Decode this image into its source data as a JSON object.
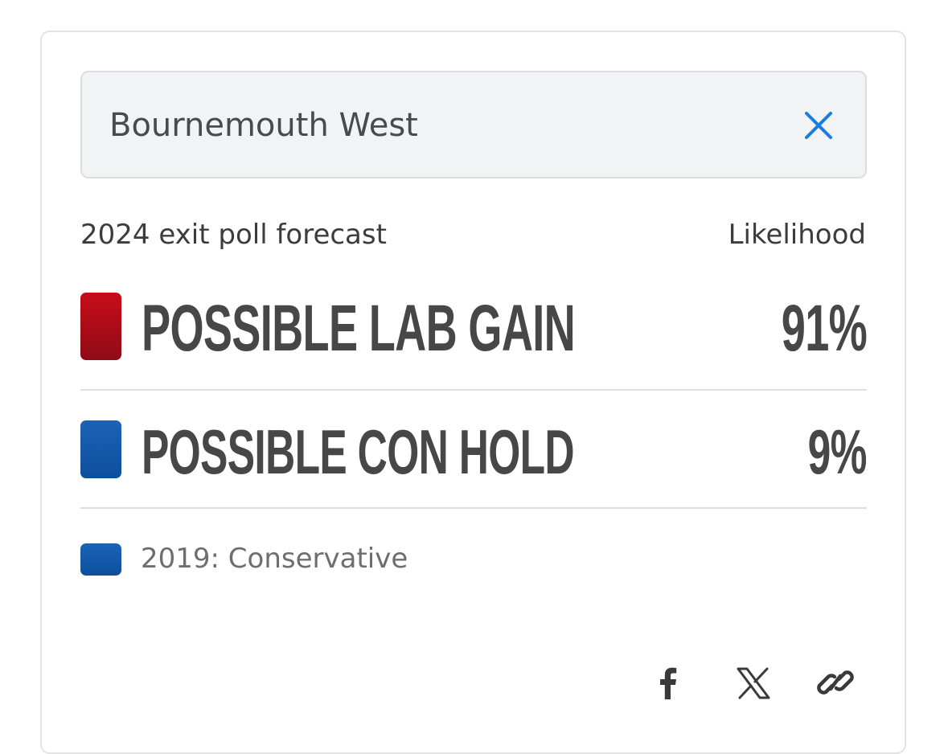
{
  "search": {
    "value": "Bournemouth West",
    "placeholder": "Bournemouth West"
  },
  "header": {
    "forecast_label": "2024 exit poll forecast",
    "likelihood_label": "Likelihood"
  },
  "outcomes": [
    {
      "label": "POSSIBLE LAB GAIN",
      "likelihood": "91%",
      "party": "LAB",
      "color": "#b50d1b"
    },
    {
      "label": "POSSIBLE CON HOLD",
      "likelihood": "9%",
      "party": "CON",
      "color": "#0f55a6"
    }
  ],
  "previous": {
    "label": "2019: Conservative",
    "color": "#0f55a6"
  },
  "share": {
    "icons": [
      "facebook-icon",
      "x-icon",
      "link-icon"
    ]
  },
  "colors": {
    "accent": "#1a7ee0",
    "lab": "#b50d1b",
    "con": "#0f55a6"
  }
}
